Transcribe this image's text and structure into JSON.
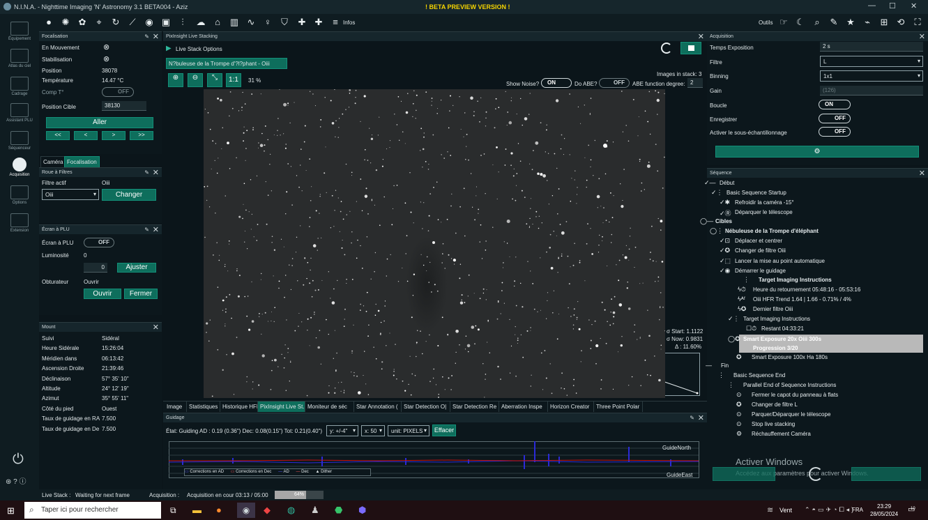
{
  "window": {
    "title": "N.I.N.A. - Nighttime Imaging 'N' Astronomy 3.1 BETA004  -  Aziz",
    "beta": "! BETA PREVIEW VERSION !",
    "min": "—",
    "max": "☐",
    "close": "✕"
  },
  "toolbar": {
    "infos": "Infos",
    "outils": "Outils"
  },
  "sidebar": [
    {
      "label": "Équipement"
    },
    {
      "label": "Atlas du ciel"
    },
    {
      "label": "Cadrage"
    },
    {
      "label": "Assistant PLU"
    },
    {
      "label": "Séquenceur"
    },
    {
      "label": "Acquisition"
    },
    {
      "label": "Options"
    },
    {
      "label": "Extension"
    }
  ],
  "focus": {
    "header": "Focalisation",
    "en_mouvement": "En Mouvement",
    "stabilisation": "Stabilisation",
    "position_label": "Position",
    "position": "38078",
    "temp_label": "Température",
    "temp": "14.47 °C",
    "comp_label": "Comp T°",
    "comp": "OFF",
    "cible_label": "Position Cible",
    "cible": "38130",
    "aller": "Aller",
    "b1": "<<",
    "b2": "<",
    "b3": ">",
    "b4": ">>",
    "tab_cam": "Caméra",
    "tab_focus": "Focalisation"
  },
  "filter": {
    "header": "Roue à Filtres",
    "actif_label": "Filtre actif",
    "actif": "Oiii",
    "select": "Oiii",
    "changer": "Changer"
  },
  "flat": {
    "header": "Écran à PLU",
    "ecran_label": "Écran à PLU",
    "ecran": "OFF",
    "lum_label": "Luminosité",
    "lum": "0",
    "lum_input": "0",
    "ajuster": "Ajuster",
    "obt_label": "Obturateur",
    "obt": "Ouvrir",
    "ouvrir": "Ouvrir",
    "fermer": "Fermer"
  },
  "mount": {
    "header": "Mount",
    "rows": [
      {
        "k": "Suivi",
        "v": "Sidéral"
      },
      {
        "k": "Heure Sidérale",
        "v": "15:26:04"
      },
      {
        "k": "Méridien dans",
        "v": "06:13:42"
      },
      {
        "k": "Ascension Droite",
        "v": "21:39:46"
      },
      {
        "k": "Déclinaison",
        "v": "57° 35' 10\""
      },
      {
        "k": "Altitude",
        "v": "24° 12' 19\""
      },
      {
        "k": "Azimut",
        "v": "35° 55' 11\""
      },
      {
        "k": "Côté du pied",
        "v": "Ouest"
      },
      {
        "k": "Taux de guidage en RA",
        "v": "7.500"
      },
      {
        "k": "Taux de guidage en De",
        "v": "7.500"
      }
    ]
  },
  "stack": {
    "header": "PixInsight Live Stacking",
    "options": "Live Stack Options",
    "target_tab": "N?buleuse de la Trompe d'?l?phant - Oiii",
    "zoom_fit": "1:1",
    "zoom": "31 %",
    "images": "Images in stack: 3",
    "show_noise": "Show Noise?",
    "noise": "ON",
    "do_abe": "Do ABE?",
    "abe": "OFF",
    "abe_deg_label": "ABE function degree:",
    "abe_deg": "2",
    "s_start": "σ Start: 1.1122",
    "s_now": "σ Now: 0.9831",
    "delta": "Δ : 11.60%"
  },
  "tabs": [
    "Image",
    "Statistiques",
    "Historique HFR",
    "PixInsight Live St.",
    "Moniteur de séc",
    "Star Annotation (",
    "Star Detection O|",
    "Star Detection Re",
    "Aberration Inspe",
    "Horizon Creator",
    "Three Point Polar"
  ],
  "guiding": {
    "header": "Guidage",
    "state": "État: Guiding  AD : 0.19 (0.36\")  Dec: 0.08(0.15\")  Tot: 0.21(0.40\")",
    "y": "y: +/-4\"",
    "x": "x: 50",
    "unit": "unit: PIXELS",
    "effacer": "Effacer",
    "north": "GuideNorth",
    "east": "GuideEast",
    "legend": [
      "Corrections en AD",
      "Corrections en Dec",
      "AD",
      "Dec",
      "Dither"
    ]
  },
  "acq": {
    "header": "Acquisition",
    "rows": [
      {
        "k": "Temps Exposition",
        "v": "2  s"
      },
      {
        "k": "Filtre",
        "v": "L"
      },
      {
        "k": "Binning",
        "v": "1x1"
      },
      {
        "k": "Gain",
        "v": "(126)"
      },
      {
        "k": "Boucle",
        "v": "ON"
      },
      {
        "k": "Enregistrer",
        "v": "OFF"
      },
      {
        "k": "Activer le sous-échantillonnage",
        "v": "OFF"
      }
    ]
  },
  "seq": {
    "header": "Séquence",
    "items": [
      "Début",
      "Basic Sequence Startup",
      "Refroidir la caméra  -15°",
      "Déparquer le télescope",
      "Cibles",
      "Nébuleuse de la Trompe d'éléphant",
      "Déplacer et centrer",
      "Changer de filtre Oiii",
      "Lancer la mise au point automatique",
      "Démarrer le guidage",
      "Target Imaging Instructions",
      "Heure du retournement 05:48:16 - 05:53:16",
      "Oiii HFR Trend  1.64 | 1.66 - 0.71% / 4%",
      "Dernier filtre  Oiii",
      "Target Imaging Instructions",
      "Restant 04:33:21",
      "Smart Exposure 20x Oiii 300s",
      "Progression 3/20",
      "Smart Exposure 100x Ha 180s",
      "Fin",
      "Basic Sequence End",
      "Parallel End of Sequence Instructions",
      "Fermer le capot du panneau à flats",
      "Changer de filtre  L",
      "Parquer/Déparquer le télescope",
      "Stop live stacking",
      "Réchauffement Caméra"
    ],
    "activate": "Activer Windows",
    "activate2": "Accédez aux paramètres pour activer Windows."
  },
  "status": {
    "live": "Live Stack :",
    "live_v": "Waiting for next frame",
    "acq": "Acquisition :",
    "acq_v": "Acquisition en cour 03:13 / 05:00",
    "pct": "64%",
    "progress": 0.64
  },
  "taskbar": {
    "search": "Taper ici pour rechercher",
    "weather": "Vent",
    "lang": "FRA",
    "time": "23:29",
    "date": "28/05/2024",
    "notif": "10"
  }
}
